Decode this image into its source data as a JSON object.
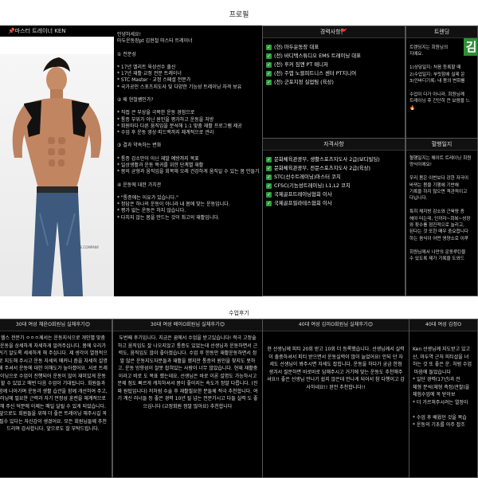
{
  "page": {
    "title": "프로필",
    "reviews_title": "수업후기"
  },
  "trainer_card": {
    "label": "📌마스터 트레이너 KEN",
    "watermark": "LAVIE.COMPANY"
  },
  "intro": {
    "text": "안녕하세요!\n마두운동장pt 김현철 마스터 트레이너\n\n① 전문성\n\n* 17년 엘리트 육상선수 출신\n* 17년 재활·교정 전문 트레이너\n* STC Master · 교정 스페셜 전문가\n* 국가공인 스포츠지도사 및 다양한 기능성 트레이닝 자격 보유\n\n② 왜 현철쌤인가?\n\n* 직접 큰 부상을 극복한 운동 경험으로\n* 통증 부위가 아닌 원인을 평가하고 운동을 처방\n* 회원마다 다른 움직임을 분석해 1:1 맞춤 재활 프로그램 제공\n* 수업 후 운동 영상·피드백까지 체계적으로 관리\n\n③ 결과 약속하는 변화\n\n* 통증 감소만이 아닌 재발 예방까지 목표\n* 일상생활과 운동 복귀를 위한 단계별 재활\n* 몸의 균형과 움직임을 회복해 오래 건강하게 움직일 수 있는 몸 만들기\n\n④ 운동에 대한 가치관\n\n* \"통증에는 이유가 있습니다.\"\n* 정답은 하나의 운동이 아니라 내 몸에 맞는 운동입니다.\n* 평가 없는 운동은 하지 않습니다.\n* 다치지 않는 몸을 만드는 것이 최고의 재활입니다."
  },
  "career": {
    "title": "경력사항🚩",
    "items": [
      "(현) 마두운동장 대표",
      "(전) 바디텍스튜디오 EMS 트레이닝 대표",
      "(전) 후커 짐앤 PT 매니저",
      "(전) 주엽 노블피트니스 센터 PT지니어",
      "(전) 군포지정 실업팀 (육상)"
    ]
  },
  "certs": {
    "title": "자격사항",
    "items": [
      "문화체육관광부, 생활스포츠지도사 2급(보디빌딩)",
      "문화체육관광부, 전문스포츠지도사 2급(육상)",
      "STC(선수트레이닝)마스터 코치",
      "CFSC(기능성트레이닝) L1,L2 코치",
      "국제골프트레이닝협회 이사",
      "국제골프필라테스협회 이사"
    ]
  },
  "right_top": {
    "title": "트렌딩",
    "badge": "김",
    "text": "트렌딩지는 회원님의\n지예요.\n\n1)상담일지: 처음 등록할 때\n2)수업일지: 부릿함에 실제 운\n3)인바디기록: 내 몸의 변화를\n\n수업이 다가 아니라, 회원님께\n트레이닝 후 간단히 큰 보람을 느\n🔥"
  },
  "right_bottom": {
    "title": "혈행일지",
    "text": "혈행일지는 웨이트 트레이닝 회원\n양식이에요!\n\n우리 몸은 이번보다 강한 자극이\n바뀌는 몸을 기행에 기반해\n기록을 하지 않으면 객관적이고\n다닙니다.\n\n특히 체지방 감소와 근육량 증\n해야 터는데, 인까자~회복~성장\n와 횟수를 점진적으로 늘리고,\n된다는 것 또한 매우 중요합니다\n하는 음식이 어떤 영양소로 이루\n\n회원님께서 나만의 운동루틴을\n수 있도록 제가 기록을 도와드"
  },
  "reviews": [
    {
      "title": "30대 여성 채윤O회원님 실체후기😊",
      "text": "헬스 전문가 ㅇㅇㅇ께서는 운동지식으로 개인별 맞춤 운동을 상세하게 자세하게 알려주십니다. 몸에 우리가 거기 알도록 세세하게 해 주십니다. 제 생각이 열정적으로 지도해 주시고 운동 자세의 메커니 즘을 자세히 설명해 주셔서 운동에 대한 이해도가 높아졌어요. 서로 트레이닝으로 수업이 진행되어 운동이 많이 재미있게 운동할 수 있었고 매번 다음 수업이 기대됩니다. 회원들과 함께 나아가며 운동과 생활 습관을 함께 개선하여 주고, 러닝에 필요한 근력과 자기 안정성 훈련을 체계적으로 해 주신 덕분에 이제는 매일 달릴 수 있게 되었습니다. 앞으로도 회원들을 위해 더 좋은 트레이닝 해주시길 꼭 필수 있다는 자신감이 생겼어요. 모든 회원님들께 추천드리며 감사합니다. 앞으로도 잘 부탁드립니다."
    },
    {
      "title": "30대 여성 배이O회원님 실체후기😊",
      "text": "두번째 후기입니다. 지금은 꿈에서 수업을 받고있습니다! 적극 고정술하고 움직임도 잘 나오지않고 통증도 있었는데 선생님과 운동하면서 근력도, 움직임도 많이 좋아졌습니다. 수업 후 한동안 재활운동하면서 정말 많은 운동지도자분들과 재활을 했지만 통증의 원인을 찾지도 못하고, 운동 방향성이 잘못 잡혀있는 사람이 너무 많았습니다. 현재 재활중이라고 비로 도 목표 했는데요. 선생님은 바로 이론 설명도 가능하시고 문제 점도 빠르게 캐치하셔서 몸이 좋아지는 속도가 정말 다릅니다. (진짜 원탑입니다) 저처럼 수술 후 재활필요한 분들께 적극 추천합니다. 여기 계신 러너들 등 좋은 경력 10년 될 넘는 전문가시고 다들 실력 도 좋으십니다 (교정회원 정말 많아요) 추천합니다"
    },
    {
      "title": "40대 여성 김미O회원님 실체후기😊",
      "text": "현 선생님께 피티 20회 받고 10회 더 등록했습니다. 선생님께서 실력이 출중하셔서 피티 받으면서 운동실력이 많이 늘었어요! 안되 던 자세도 선생님이 봐주시면 자세도 잡힙니다. 운동을 하다가 궁금 한점 생겨서 질문하면 바로바로 답해주시고 거기에 맞는 운동도 추천해주셔요!! 좋은 선생님 만나기 쉽지 않은데 만나게 되어서 참 다행이고 감사하네요!! 완전 추천합니다!!"
    },
    {
      "title": "40대 여성 김정O",
      "text": "Ken 선생님께 지도받고 있고\n산, 마두역 근처 피티샵을 녀\n하는 것 또 좋은 운. 처럼 수업\n 마음에 들었습니다\n* 일단 경력(17년)과 전\n체형 분석(체형 측정/관찰)을\n체험수업에 꼭 받아보\n* 더 가르쳐주시려는 열정이\n\n* 수업 후 배웠던 것을 복습\n* 운동의 기초를 아주 잡조"
    }
  ]
}
